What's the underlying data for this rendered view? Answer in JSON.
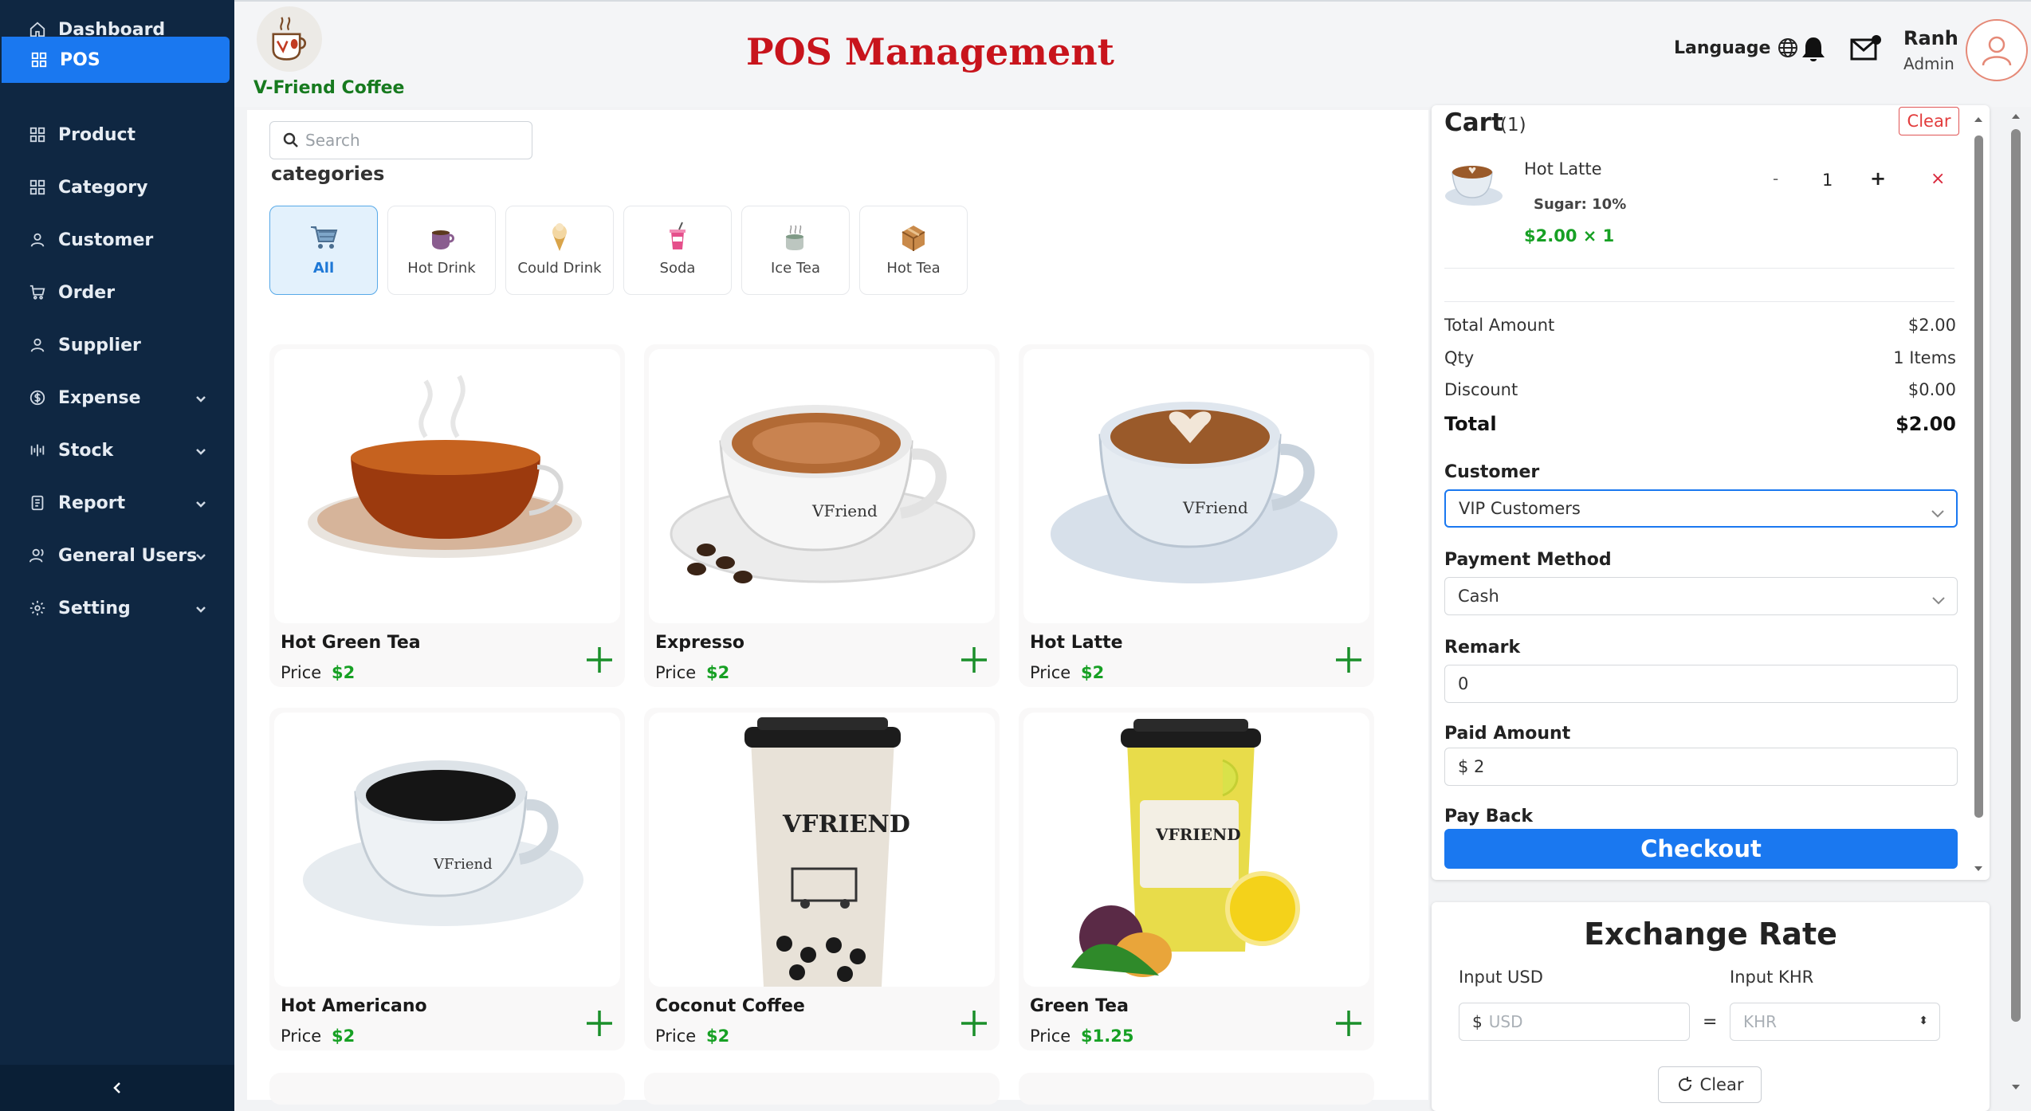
{
  "sidebar": {
    "items": [
      {
        "label": "Dashboard",
        "icon": "home-icon"
      },
      {
        "label": "POS",
        "icon": "grid-icon",
        "active": true
      },
      {
        "label": "Product",
        "icon": "grid-icon"
      },
      {
        "label": "Category",
        "icon": "grid-icon"
      },
      {
        "label": "Customer",
        "icon": "user-icon"
      },
      {
        "label": "Order",
        "icon": "cart-icon"
      },
      {
        "label": "Supplier",
        "icon": "user-icon"
      },
      {
        "label": "Expense",
        "icon": "dollar-icon",
        "expandable": true
      },
      {
        "label": "Stock",
        "icon": "stock-icon",
        "expandable": true
      },
      {
        "label": "Report",
        "icon": "report-icon",
        "expandable": true
      },
      {
        "label": "General Users",
        "icon": "users-icon",
        "expandable": true
      },
      {
        "label": "Setting",
        "icon": "gear-icon",
        "expandable": true
      }
    ],
    "collapse_icon": "chevron-left-icon"
  },
  "header": {
    "brand": "V-Friend Coffee",
    "title": "POS Management",
    "language_label": "Language",
    "user_name": "Ranh",
    "user_role": "Admin"
  },
  "search": {
    "placeholder": "Search"
  },
  "categories": {
    "heading": "categories",
    "items": [
      "All",
      "Hot Drink",
      "Could Drink",
      "Soda",
      "Ice Tea",
      "Hot Tea"
    ],
    "selected": "All"
  },
  "products": {
    "price_label": "Price",
    "items": [
      {
        "name": "Hot Green Tea",
        "price": "$2"
      },
      {
        "name": "Expresso",
        "price": "$2"
      },
      {
        "name": "Hot Latte",
        "price": "$2"
      },
      {
        "name": "Hot Americano",
        "price": "$2"
      },
      {
        "name": "Coconut Coffee",
        "price": "$2"
      },
      {
        "name": "Green Tea",
        "price": "$1.25"
      }
    ]
  },
  "cart": {
    "title": "Cart",
    "count": "(1)",
    "clear_label": "Clear",
    "item": {
      "name": "Hot Latte",
      "sugar": "Sugar: 10%",
      "price_line": "$2.00 × 1",
      "qty": "1",
      "minus": "-",
      "plus": "+",
      "remove": "×"
    },
    "summary": {
      "total_amount_label": "Total Amount",
      "total_amount": "$2.00",
      "qty_label": "Qty",
      "qty": "1 Items",
      "discount_label": "Discount",
      "discount": "$0.00",
      "total_label": "Total",
      "total": "$2.00"
    },
    "customer_label": "Customer",
    "customer_value": "VIP Customers",
    "payment_label": "Payment Method",
    "payment_value": "Cash",
    "remark_label": "Remark",
    "remark_value": "0",
    "paid_label": "Paid Amount",
    "paid_value": "$ 2",
    "payback_label": "Pay Back",
    "checkout_label": "Checkout"
  },
  "exchange": {
    "title": "Exchange Rate",
    "usd_label": "Input USD",
    "khr_label": "Input KHR",
    "usd_prefix": "$",
    "usd_placeholder": "USD",
    "khr_placeholder": "KHR",
    "equals": "=",
    "clear_label": "Clear"
  },
  "colors": {
    "sidebar_bg": "#0f2742",
    "accent": "#1a78f0",
    "title_red": "#c8141c",
    "brand_green": "#177a1f",
    "price_green": "#17a024"
  }
}
